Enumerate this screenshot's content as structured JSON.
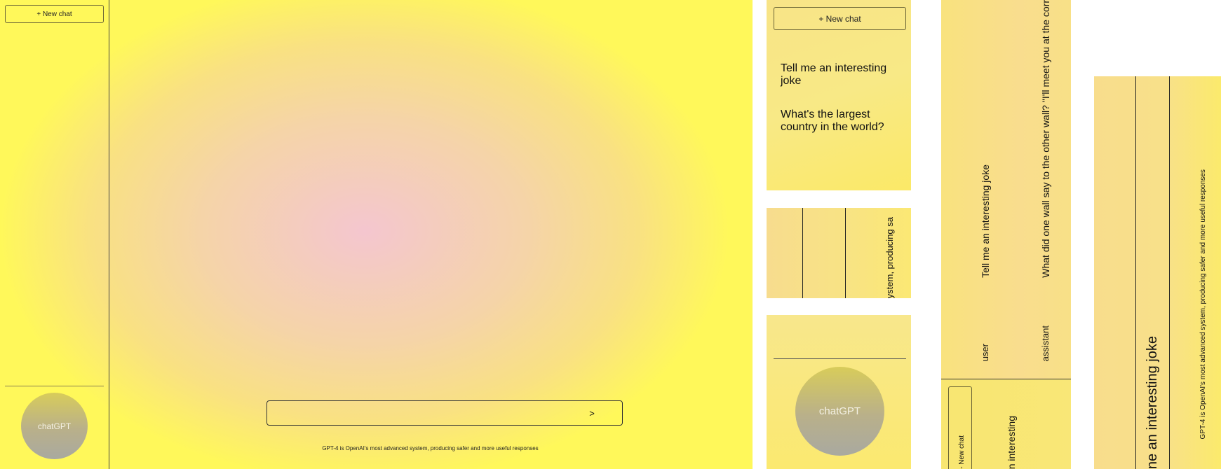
{
  "sidebar": {
    "new_chat_label": "+ New chat",
    "chats": [
      "Tell me an interesting joke",
      "What's the largest country in the world?"
    ],
    "logo_text": "chatGPT"
  },
  "composer": {
    "send_label": ">",
    "footer": "GPT-4 is OpenAI's most advanced system, producing safer and more useful responses"
  },
  "strip": {
    "footer_fragment": "ystem, producing sa"
  },
  "conversation": {
    "user_role": "user",
    "assistant_role": "assistant",
    "user_message": "Tell me an interesting joke",
    "assistant_message": "What did one wall say to the other wall? \"I'll meet you at the corr",
    "new_chat_fragment": "- New chat",
    "chat_fragment": "n interesting"
  },
  "rotated_composer": {
    "input_text": "ne an interesting joke",
    "footer": "GPT-4 is OpenAI's most advanced system, producing safer and more useful responses"
  },
  "colors": {
    "yellow": "#fff85a",
    "pink": "#f4c6cf",
    "sand": "#f5d4a8"
  }
}
